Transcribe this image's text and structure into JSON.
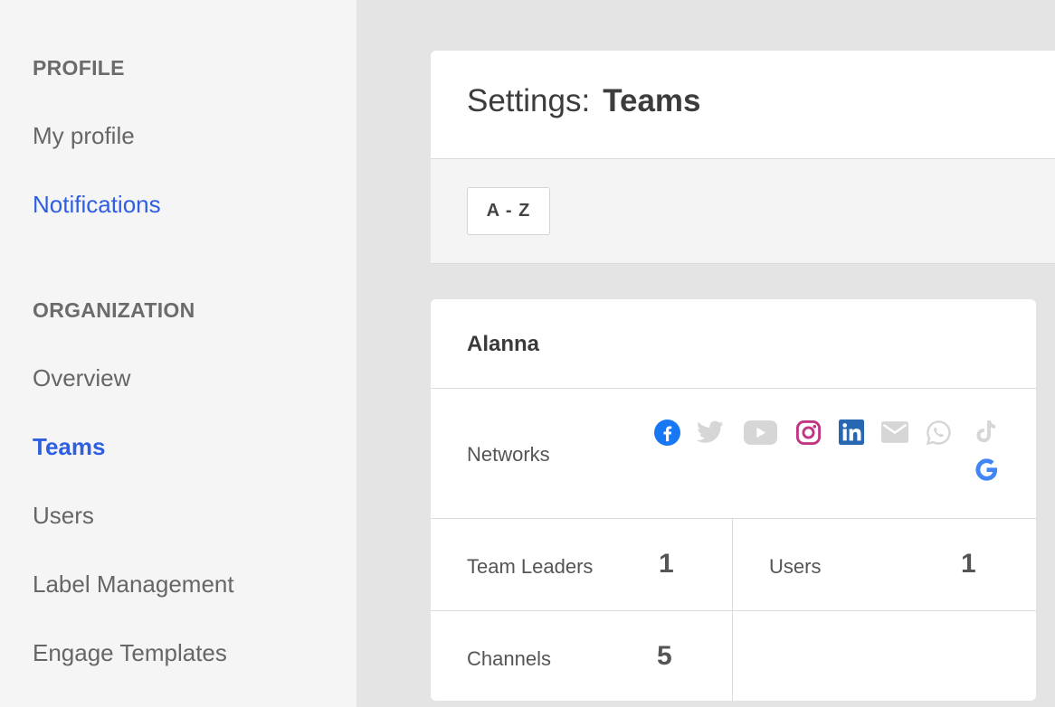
{
  "sidebar": {
    "profile_heading": "PROFILE",
    "profile_items": [
      {
        "label": "My profile"
      },
      {
        "label": "Notifications"
      }
    ],
    "organization_heading": "ORGANIZATION",
    "organization_items": [
      {
        "label": "Overview"
      },
      {
        "label": "Teams"
      },
      {
        "label": "Users"
      },
      {
        "label": "Label Management"
      },
      {
        "label": "Engage Templates"
      }
    ]
  },
  "header": {
    "title_prefix": "Settings:",
    "title_name": "Teams"
  },
  "toolbar": {
    "sort_label": "A - Z"
  },
  "team": {
    "name": "Alanna",
    "networks_label": "Networks",
    "networks": [
      {
        "icon": "facebook-icon",
        "active": true,
        "color": "#1877f2"
      },
      {
        "icon": "twitter-icon",
        "active": false,
        "color": "#d6d6d6"
      },
      {
        "icon": "youtube-icon",
        "active": false,
        "color": "#d6d6d6"
      },
      {
        "icon": "instagram-icon",
        "active": true,
        "color": "#c13584"
      },
      {
        "icon": "linkedin-icon",
        "active": true,
        "color": "#2867b2"
      },
      {
        "icon": "email-icon",
        "active": false,
        "color": "#d6d6d6"
      },
      {
        "icon": "whatsapp-icon",
        "active": false,
        "color": "#d6d6d6"
      },
      {
        "icon": "tiktok-icon",
        "active": false,
        "color": "#d6d6d6"
      },
      {
        "icon": "google-icon",
        "active": true,
        "color": "#4285f4"
      }
    ],
    "team_leaders_label": "Team Leaders",
    "team_leaders_count": "1",
    "users_label": "Users",
    "users_count": "1",
    "channels_label": "Channels",
    "channels_count": "5"
  },
  "colors": {
    "accent": "#2f5ee0",
    "sidebar_bg": "#f5f5f5",
    "main_bg": "#e4e4e4"
  }
}
